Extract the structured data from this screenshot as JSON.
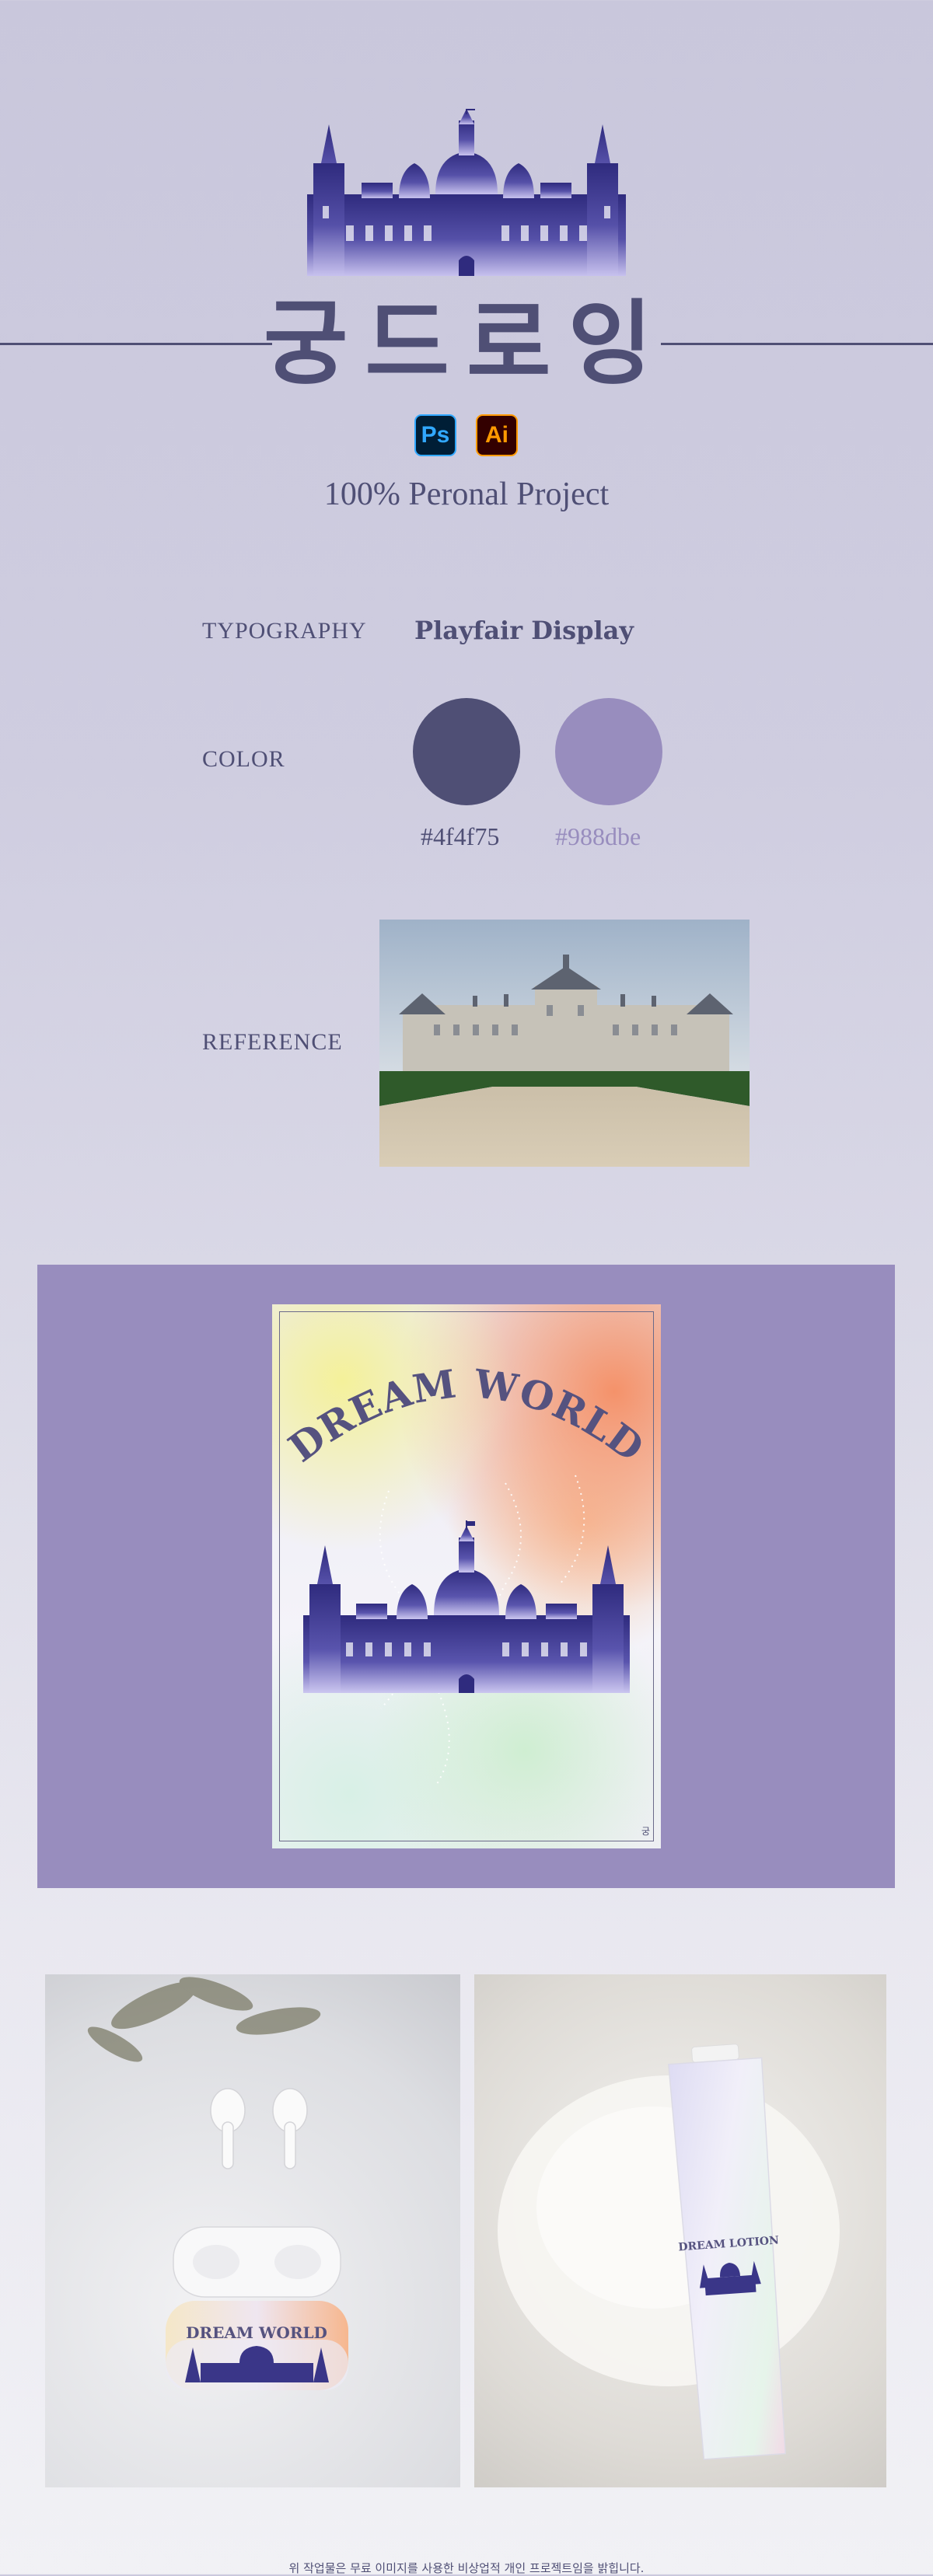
{
  "header": {
    "title": "궁드로잉",
    "tools": [
      "Ps",
      "Ai"
    ],
    "subtitle": "100% Peronal Project"
  },
  "specs": {
    "typography_label": "TYPOGRAPHY",
    "font_name": "Playfair Display",
    "color_label": "COLOR",
    "colors": [
      {
        "hex": "#4f4f75",
        "label": "#4f4f75"
      },
      {
        "hex": "#988dbe",
        "label": "#988dbe"
      }
    ],
    "reference_label": "REFERENCE"
  },
  "poster": {
    "title": "DREAM WORLD",
    "mark": "궁"
  },
  "mockups": {
    "airpods_text": "DREAM WORLD",
    "lotion_text": "DREAM LOTION"
  },
  "footer": "위 작업물은 무료 이미지를 사용한 비상업적 개인 프로젝트임을 밝힙니다."
}
